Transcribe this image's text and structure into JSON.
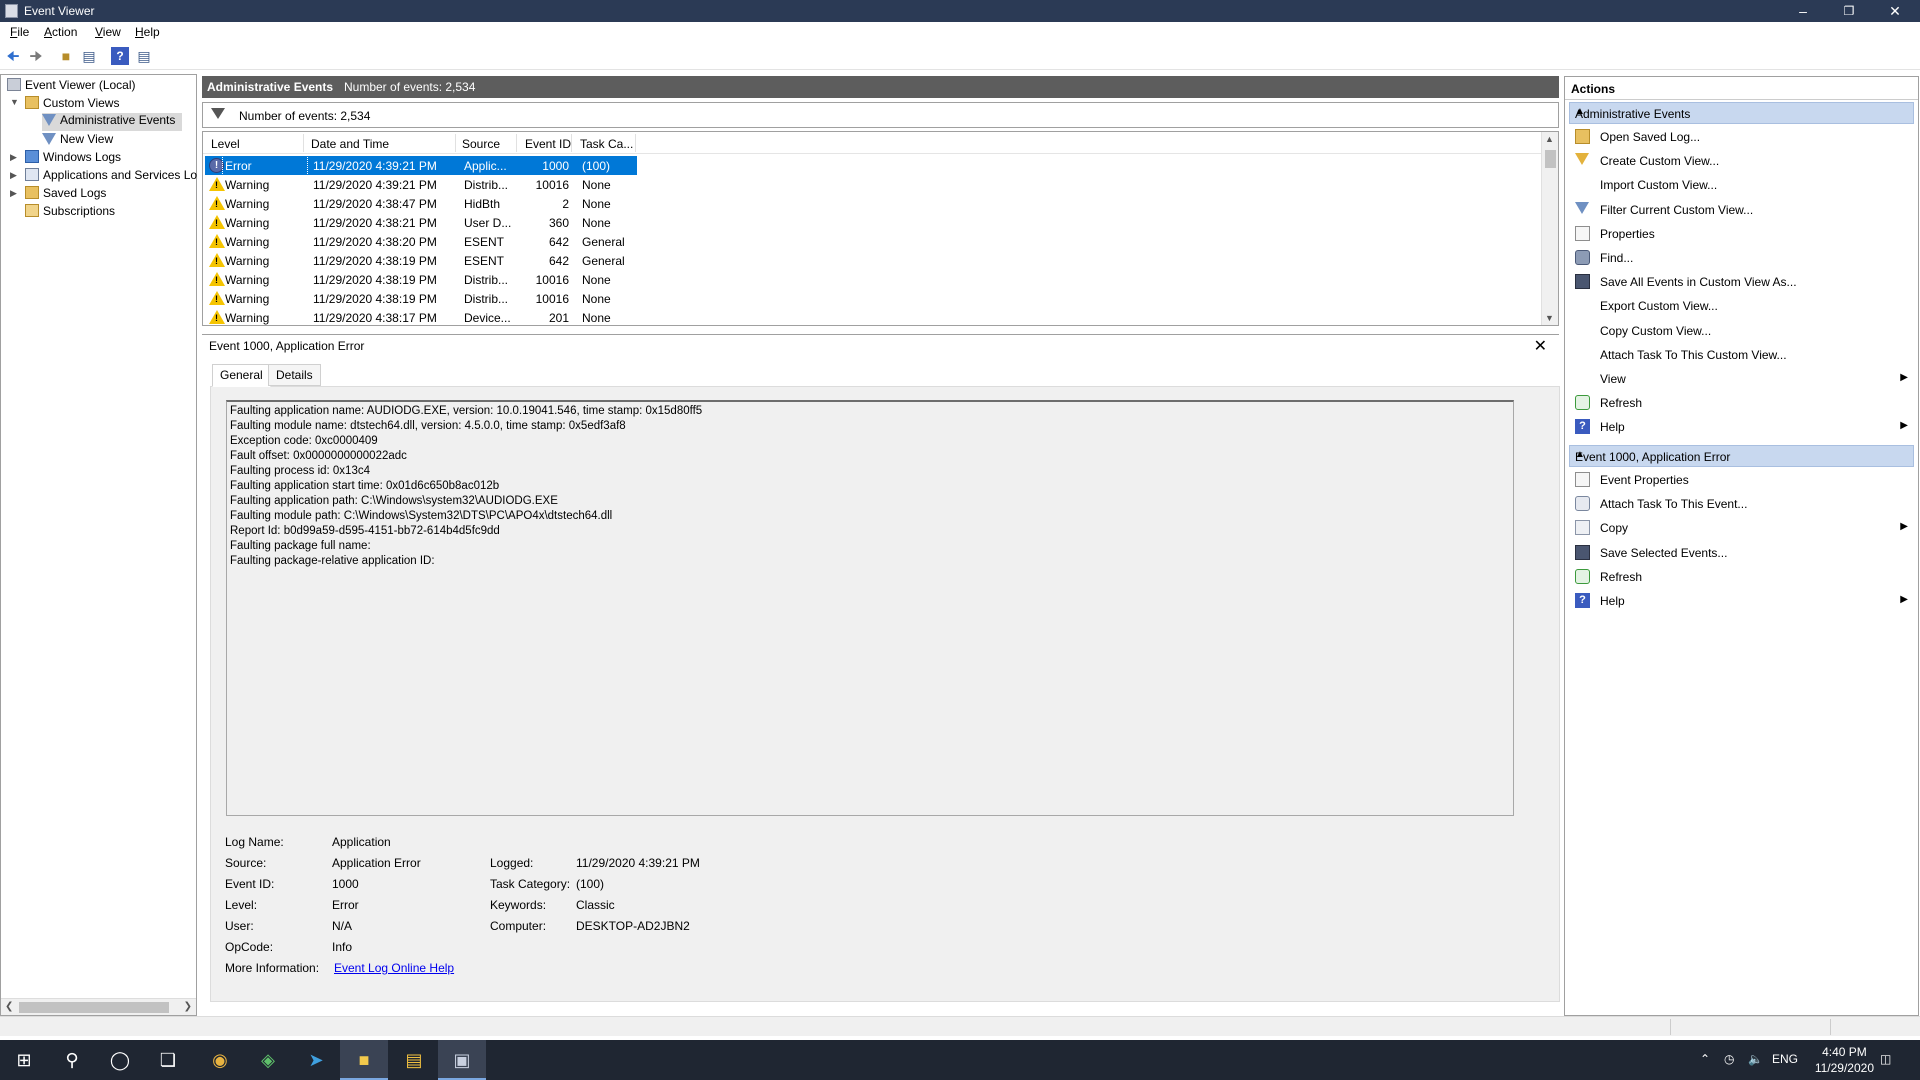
{
  "window": {
    "title": "Event Viewer"
  },
  "menu": [
    {
      "label": "File",
      "u": "F"
    },
    {
      "label": "Action",
      "u": "A"
    },
    {
      "label": "View",
      "u": "V"
    },
    {
      "label": "Help",
      "u": "H"
    }
  ],
  "toolbar": {
    "buttons": [
      "back-icon",
      "forward-icon",
      "up-icon",
      "show-hide-tree-icon",
      "help-icon",
      "show-hide-action-pane-icon"
    ]
  },
  "tree": {
    "root": "Event Viewer (Local)",
    "custom_views": "Custom Views",
    "administrative_events": "Administrative Events",
    "new_view": "New View",
    "windows_logs": "Windows Logs",
    "apps_services": "Applications and Services Lo",
    "saved_logs": "Saved Logs",
    "subscriptions": "Subscriptions"
  },
  "center": {
    "title": "Administrative Events",
    "count": "Number of events: 2,534",
    "filter_text": "Number of events: 2,534"
  },
  "grid": {
    "columns": [
      "Level",
      "Date and Time",
      "Source",
      "Event ID",
      "Task Ca..."
    ],
    "rows": [
      {
        "level": "Error",
        "icon": "error",
        "date": "11/29/2020 4:39:21 PM",
        "source": "Applic...",
        "id": "1000",
        "task": "(100)",
        "selected": true
      },
      {
        "level": "Warning",
        "icon": "warning",
        "date": "11/29/2020 4:39:21 PM",
        "source": "Distrib...",
        "id": "10016",
        "task": "None"
      },
      {
        "level": "Warning",
        "icon": "warning",
        "date": "11/29/2020 4:38:47 PM",
        "source": "HidBth",
        "id": "2",
        "task": "None"
      },
      {
        "level": "Warning",
        "icon": "warning",
        "date": "11/29/2020 4:38:21 PM",
        "source": "User D...",
        "id": "360",
        "task": "None"
      },
      {
        "level": "Warning",
        "icon": "warning",
        "date": "11/29/2020 4:38:20 PM",
        "source": "ESENT",
        "id": "642",
        "task": "General"
      },
      {
        "level": "Warning",
        "icon": "warning",
        "date": "11/29/2020 4:38:19 PM",
        "source": "ESENT",
        "id": "642",
        "task": "General"
      },
      {
        "level": "Warning",
        "icon": "warning",
        "date": "11/29/2020 4:38:19 PM",
        "source": "Distrib...",
        "id": "10016",
        "task": "None"
      },
      {
        "level": "Warning",
        "icon": "warning",
        "date": "11/29/2020 4:38:19 PM",
        "source": "Distrib...",
        "id": "10016",
        "task": "None"
      },
      {
        "level": "Warning",
        "icon": "warning",
        "date": "11/29/2020 4:38:17 PM",
        "source": "Device...",
        "id": "201",
        "task": "None"
      }
    ]
  },
  "detail": {
    "title": "Event 1000, Application Error",
    "tabs": [
      "General",
      "Details"
    ],
    "message_lines": [
      "Faulting application name: AUDIODG.EXE, version: 10.0.19041.546, time stamp: 0x15d80ff5",
      "Faulting module name: dtstech64.dll, version: 4.5.0.0, time stamp: 0x5edf3af8",
      "Exception code: 0xc0000409",
      "Fault offset: 0x0000000000022adc",
      "Faulting process id: 0x13c4",
      "Faulting application start time: 0x01d6c650b8ac012b",
      "Faulting application path: C:\\Windows\\system32\\AUDIODG.EXE",
      "Faulting module path: C:\\Windows\\System32\\DTS\\PC\\APO4x\\dtstech64.dll",
      "Report Id: b0d99a59-d595-4151-bb72-614b4d5fc9dd",
      "Faulting package full name:",
      "Faulting package-relative application ID:"
    ],
    "fields": {
      "log_name_label": "Log Name:",
      "log_name": "Application",
      "source_label": "Source:",
      "source": "Application Error",
      "logged_label": "Logged:",
      "logged": "11/29/2020 4:39:21 PM",
      "event_id_label": "Event ID:",
      "event_id": "1000",
      "task_category_label": "Task Category:",
      "task_category": "(100)",
      "level_label": "Level:",
      "level": "Error",
      "keywords_label": "Keywords:",
      "keywords": "Classic",
      "user_label": "User:",
      "user": "N/A",
      "computer_label": "Computer:",
      "computer": "DESKTOP-AD2JBN2",
      "opcode_label": "OpCode:",
      "opcode": "Info",
      "more_info_label": "More Information:",
      "more_info_link": "Event Log Online Help"
    }
  },
  "actions": {
    "title": "Actions",
    "section1": "Administrative Events",
    "section1_items": [
      {
        "label": "Open Saved Log...",
        "icon": "folder"
      },
      {
        "label": "Create Custom View...",
        "icon": "filter-y"
      },
      {
        "label": "Import Custom View...",
        "icon": ""
      },
      {
        "label": "Filter Current Custom View...",
        "icon": "filter"
      },
      {
        "label": "Properties",
        "icon": "doc"
      },
      {
        "label": "Find...",
        "icon": "find"
      },
      {
        "label": "Save All Events in Custom View As...",
        "icon": "save"
      },
      {
        "label": "Export Custom View...",
        "icon": ""
      },
      {
        "label": "Copy Custom View...",
        "icon": ""
      },
      {
        "label": "Attach Task To This Custom View...",
        "icon": ""
      },
      {
        "label": "View",
        "icon": "",
        "submenu": true
      },
      {
        "label": "Refresh",
        "icon": "refresh"
      },
      {
        "label": "Help",
        "icon": "help",
        "submenu": true
      }
    ],
    "section2": "Event 1000, Application Error",
    "section2_items": [
      {
        "label": "Event Properties",
        "icon": "doc"
      },
      {
        "label": "Attach Task To This Event...",
        "icon": "task"
      },
      {
        "label": "Copy",
        "icon": "copy",
        "submenu": true
      },
      {
        "label": "Save Selected Events...",
        "icon": "save"
      },
      {
        "label": "Refresh",
        "icon": "refresh"
      },
      {
        "label": "Help",
        "icon": "help",
        "submenu": true
      }
    ]
  },
  "taskbar": {
    "apps": [
      "start-icon",
      "search-icon",
      "cortana-icon",
      "task-view-icon",
      "chrome-icon",
      "edge-icon",
      "telegram-icon",
      "sticky-notes-icon",
      "file-explorer-icon",
      "event-viewer-icon"
    ],
    "lang": "ENG",
    "time": "4:40 PM",
    "date": "11/29/2020"
  }
}
